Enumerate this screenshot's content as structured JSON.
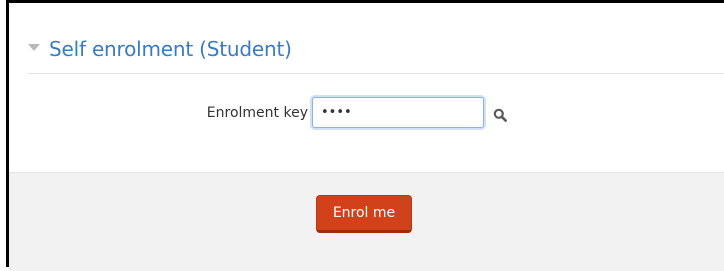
{
  "section": {
    "title": "Self enrolment (Student)",
    "collapse_icon": "chevron-down-icon"
  },
  "form": {
    "enrolment_key_label": "Enrolment key",
    "enrolment_key_value": "••••",
    "reveal_icon": "search-icon"
  },
  "actions": {
    "enrol_label": "Enrol me"
  },
  "colors": {
    "title": "#3b7bbf",
    "button": "#d2421a",
    "panel": "#f2f2f2"
  }
}
